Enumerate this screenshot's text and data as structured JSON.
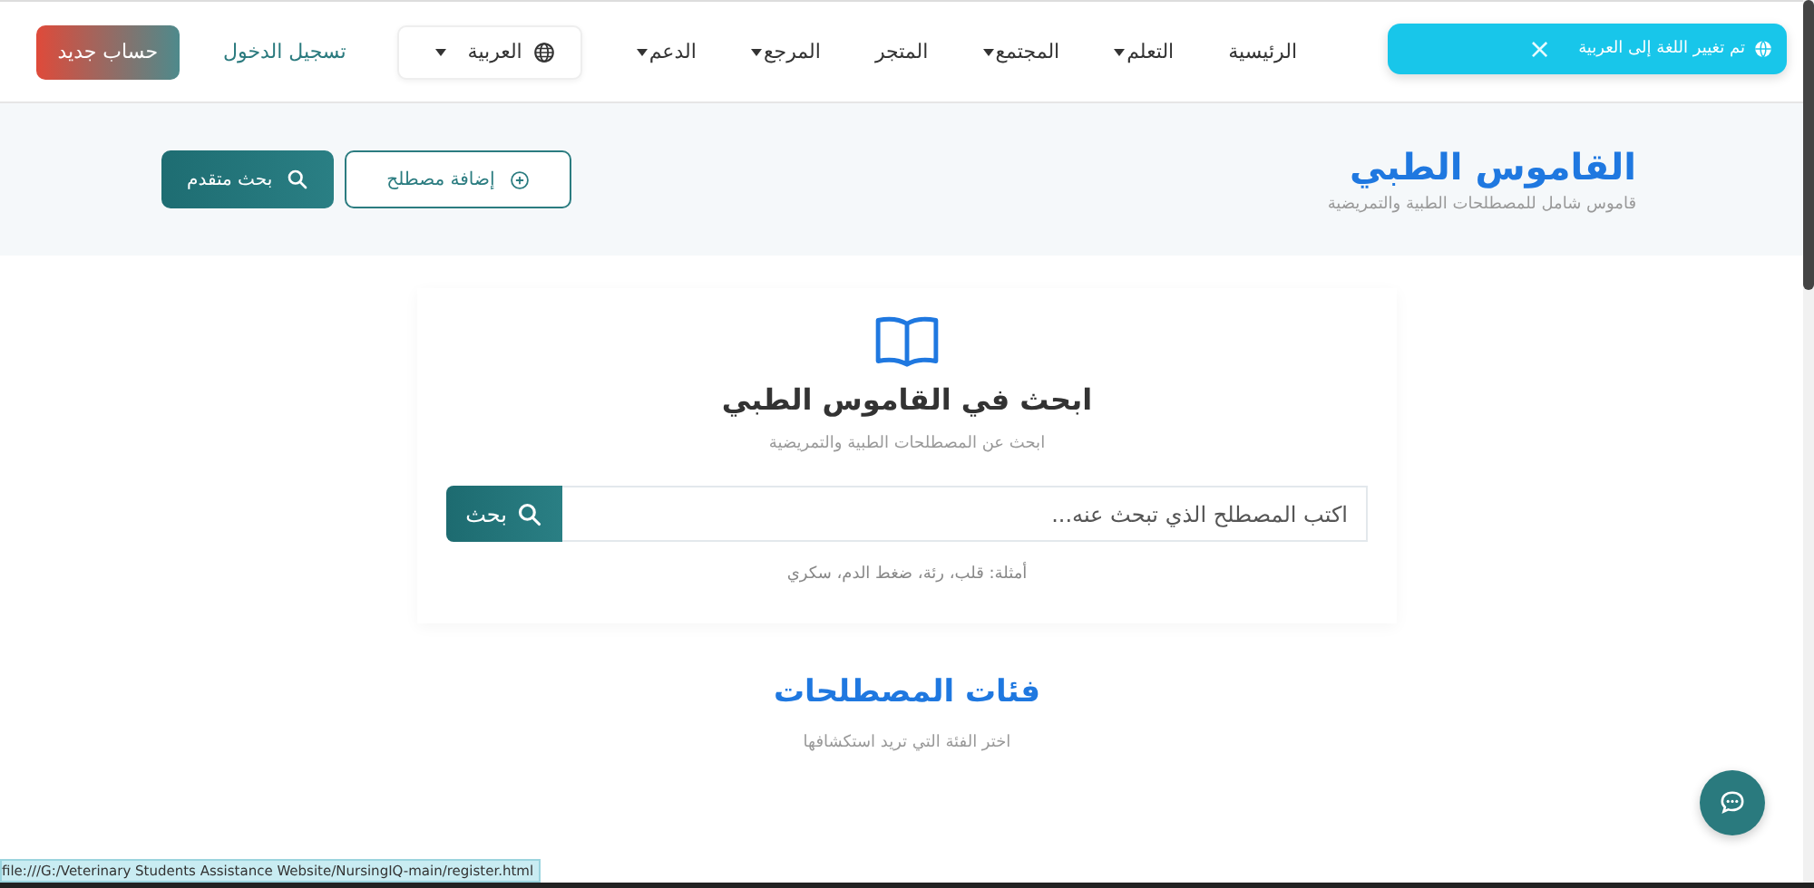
{
  "toast": {
    "message": "تم تغيير اللغة إلى العربية",
    "close": "×"
  },
  "nav": {
    "items": [
      {
        "label": "الرئيسية",
        "dropdown": false
      },
      {
        "label": "التعلم",
        "dropdown": true
      },
      {
        "label": "المجتمع",
        "dropdown": true
      },
      {
        "label": "المتجر",
        "dropdown": false
      },
      {
        "label": "المرجع",
        "dropdown": true
      },
      {
        "label": "الدعم",
        "dropdown": true
      }
    ],
    "language": "العربية",
    "login": "تسجيل الدخول",
    "register": "حساب جديد"
  },
  "hero": {
    "title": "القاموس الطبي",
    "subtitle": "قاموس شامل للمصطلحات الطبية والتمريضية",
    "add_button": "إضافة مصطلح",
    "advanced_button": "بحث متقدم"
  },
  "search": {
    "title": "ابحث في القاموس الطبي",
    "subtitle": "ابحث عن المصطلحات الطبية والتمريضية",
    "placeholder": "اكتب المصطلح الذي تبحث عنه...",
    "button": "بحث",
    "examples": "أمثلة: قلب، رئة، ضغط الدم، سكري"
  },
  "categories": {
    "title": "فئات المصطلحات",
    "subtitle": "اختر الفئة التي تريد استكشافها"
  },
  "status_bar": "file:///G:/Veterinary Students Assistance Website/NursingIQ-main/register.html"
}
